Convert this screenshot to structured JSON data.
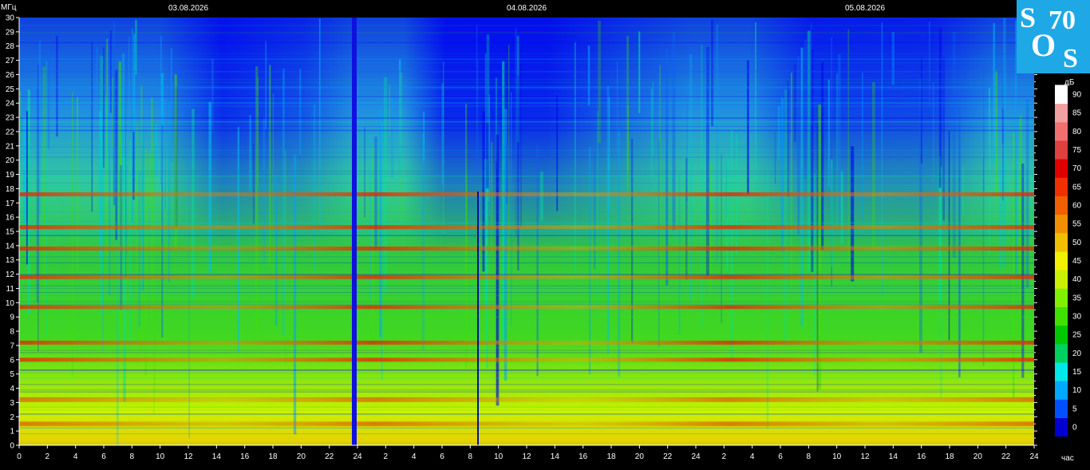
{
  "chart_data": {
    "type": "heatmap",
    "title": "",
    "ylabel": "МГц",
    "xlabel": "час",
    "colorbar_label": "дБ",
    "ylim": [
      0,
      30
    ],
    "x_range_hours": [
      0,
      72
    ],
    "dates": [
      "03.08.2026",
      "04.08.2026",
      "05.08.2026"
    ],
    "y_ticks": [
      0,
      1,
      2,
      3,
      4,
      5,
      6,
      7,
      8,
      9,
      10,
      11,
      12,
      13,
      14,
      15,
      16,
      17,
      18,
      19,
      20,
      21,
      22,
      23,
      24,
      25,
      26,
      27,
      28,
      29,
      30
    ],
    "x_tick_labels": [
      "0",
      "2",
      "4",
      "6",
      "8",
      "10",
      "12",
      "14",
      "16",
      "18",
      "20",
      "22",
      "24",
      "2",
      "4",
      "6",
      "8",
      "10",
      "12",
      "14",
      "16",
      "18",
      "20",
      "22",
      "24",
      "2",
      "4",
      "6",
      "8",
      "10",
      "12",
      "14",
      "16",
      "18",
      "20",
      "22",
      "24"
    ],
    "colorbar_ticks": [
      0,
      5,
      10,
      15,
      20,
      25,
      30,
      35,
      40,
      45,
      50,
      55,
      60,
      65,
      70,
      75,
      80,
      85,
      90
    ],
    "colorbar_colors": [
      "#0000d0",
      "#0050ff",
      "#00a8ff",
      "#00e8e8",
      "#00d060",
      "#00c800",
      "#40e000",
      "#80f000",
      "#c8f000",
      "#f0f000",
      "#f0c000",
      "#f09000",
      "#f06000",
      "#f03000",
      "#e00000",
      "#e04040",
      "#f07070",
      "#f0a0a0",
      "#ffffff"
    ],
    "bands_mhz": [
      1.5,
      3.2,
      6.0,
      7.2,
      9.7,
      11.8,
      13.8,
      15.3,
      17.6
    ],
    "logo_text": "SOS70"
  }
}
